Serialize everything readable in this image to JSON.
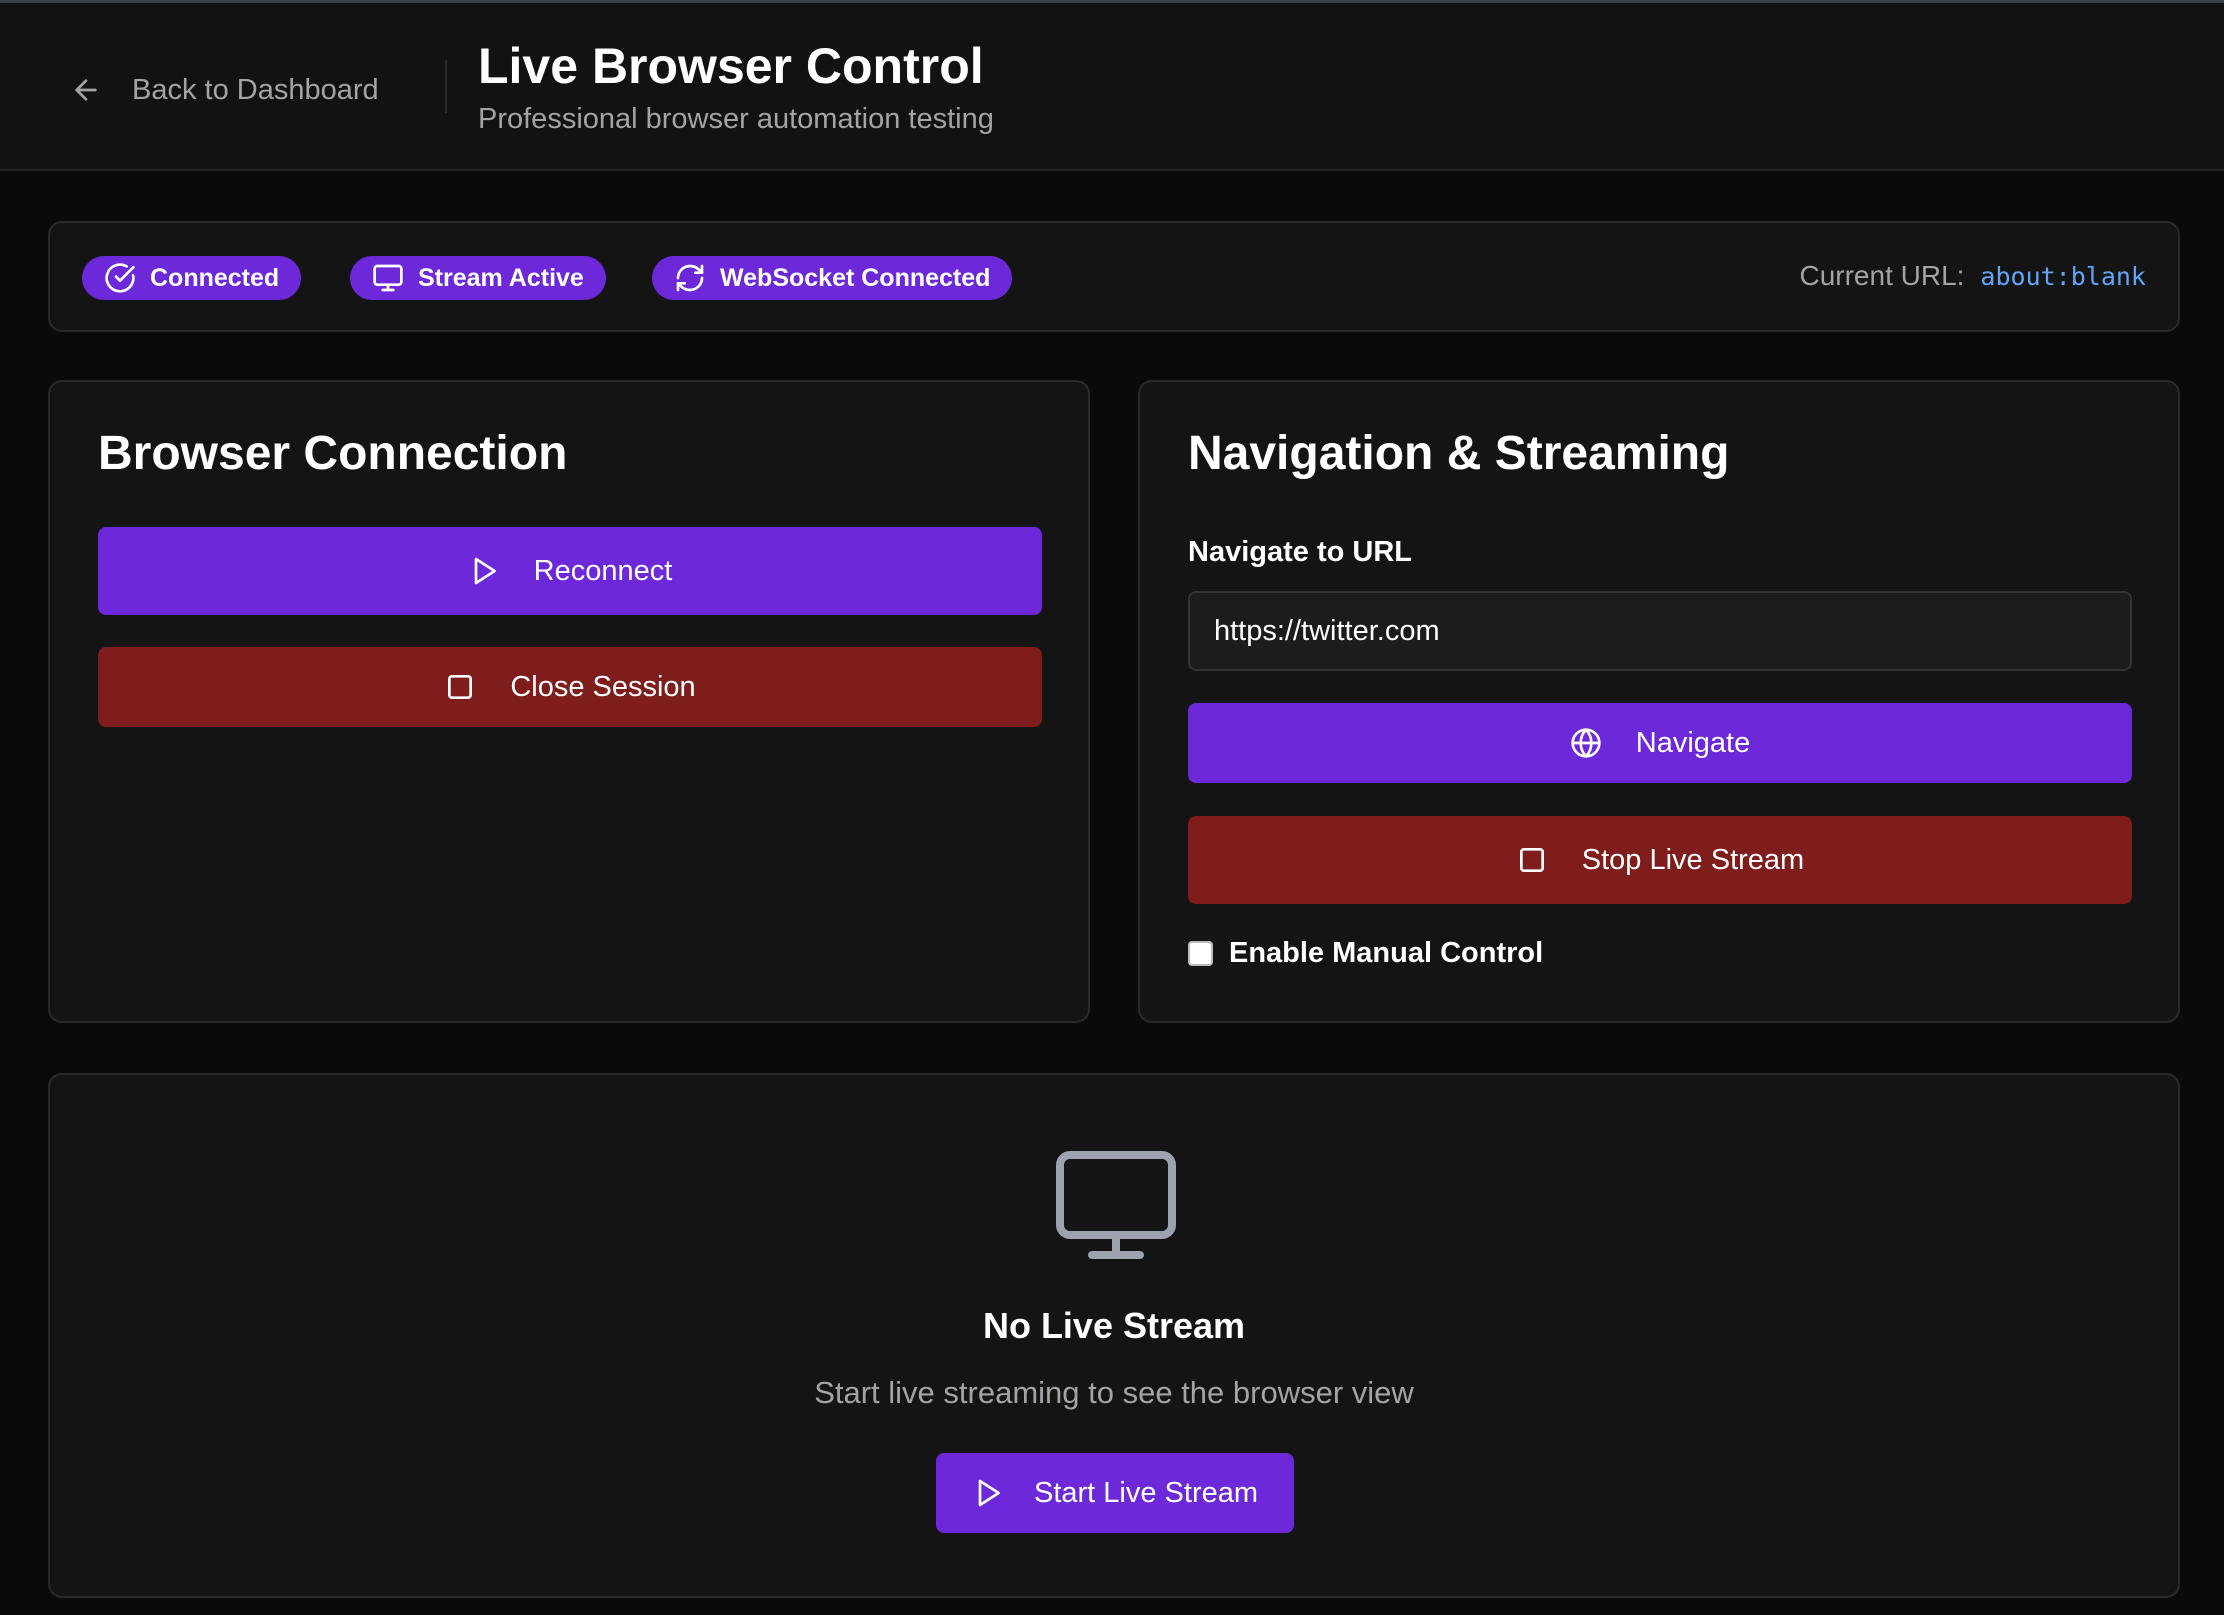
{
  "header": {
    "back_label": "Back to Dashboard",
    "title": "Live Browser Control",
    "subtitle": "Professional browser automation testing"
  },
  "status": {
    "badges": [
      {
        "label": "Connected",
        "icon": "check-circle-icon"
      },
      {
        "label": "Stream Active",
        "icon": "monitor-icon"
      },
      {
        "label": "WebSocket Connected",
        "icon": "refresh-icon"
      }
    ],
    "current_url_label": "Current URL:",
    "current_url": "about:blank"
  },
  "connection": {
    "title": "Browser Connection",
    "reconnect_label": "Reconnect",
    "close_label": "Close Session"
  },
  "navigation": {
    "title": "Navigation & Streaming",
    "url_label": "Navigate to URL",
    "url_value": "https://twitter.com",
    "navigate_label": "Navigate",
    "stop_label": "Stop Live Stream",
    "manual_control_label": "Enable Manual Control",
    "manual_control_checked": false
  },
  "stream": {
    "empty_title": "No Live Stream",
    "empty_subtitle": "Start live streaming to see the browser view",
    "start_label": "Start Live Stream"
  },
  "colors": {
    "accent": "#6d28d9",
    "danger": "#7f1d1d",
    "link": "#60a5fa",
    "background": "#0a0a0a",
    "card": "#141414"
  }
}
